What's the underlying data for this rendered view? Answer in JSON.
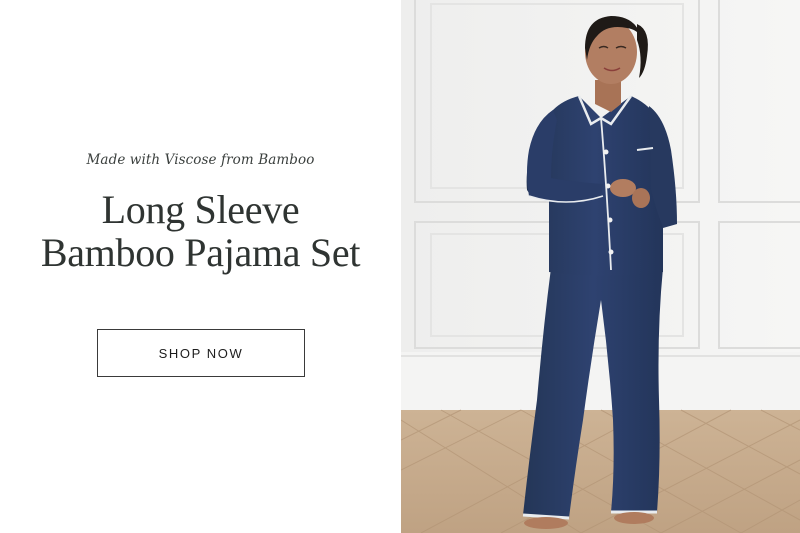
{
  "hero": {
    "tagline": "Made with Viscose from Bamboo",
    "title_line1": "Long Sleeve",
    "title_line2": "Bamboo Pajama Set",
    "cta_label": "SHOP NOW"
  },
  "colors": {
    "text_dark": "#2f3432",
    "pajama_navy": "#2c3e66",
    "piping": "#e9ecef",
    "wall": "#f2f2f1",
    "floor": "#c9ac8c"
  }
}
